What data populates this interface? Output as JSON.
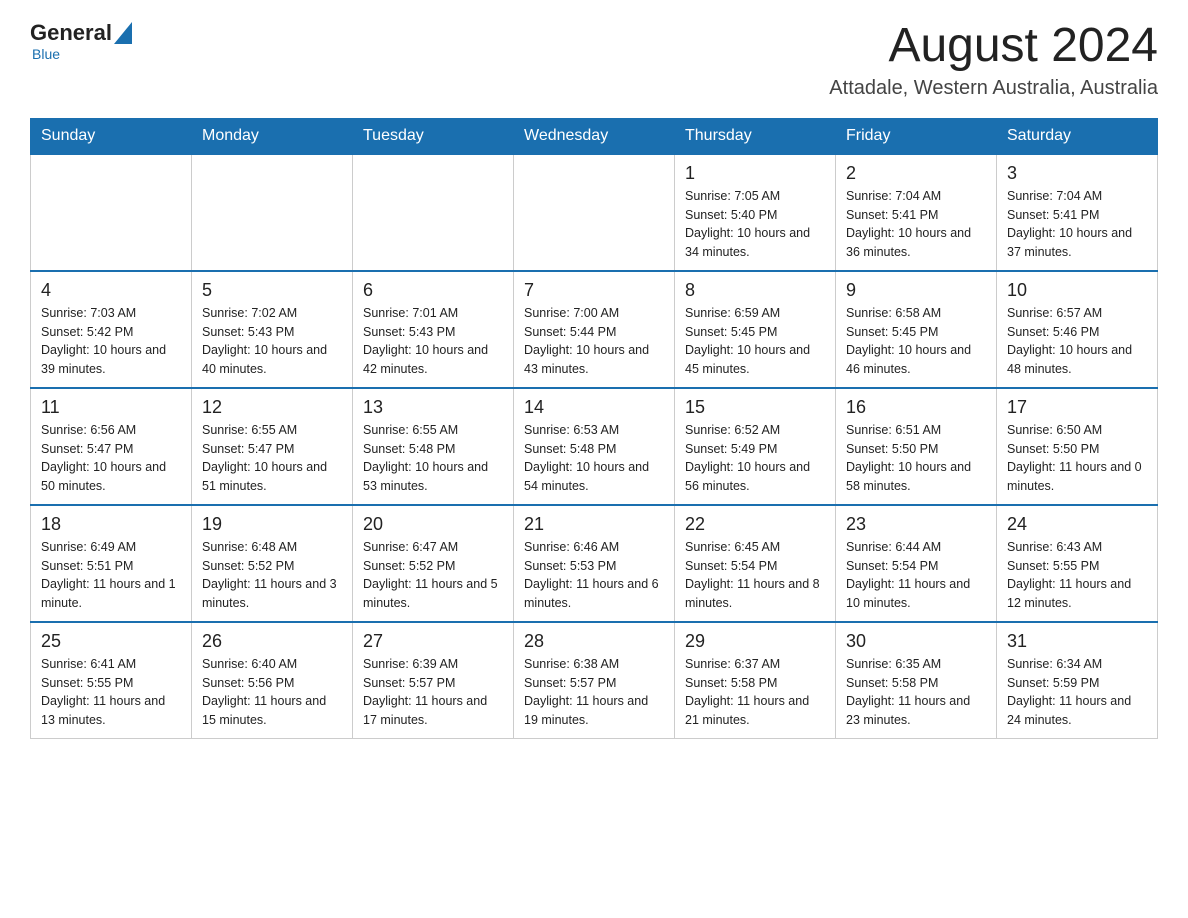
{
  "header": {
    "logo": {
      "general": "General",
      "blue": "Blue"
    },
    "month": "August 2024",
    "location": "Attadale, Western Australia, Australia"
  },
  "weekdays": [
    "Sunday",
    "Monday",
    "Tuesday",
    "Wednesday",
    "Thursday",
    "Friday",
    "Saturday"
  ],
  "weeks": [
    [
      {
        "day": "",
        "info": ""
      },
      {
        "day": "",
        "info": ""
      },
      {
        "day": "",
        "info": ""
      },
      {
        "day": "",
        "info": ""
      },
      {
        "day": "1",
        "info": "Sunrise: 7:05 AM\nSunset: 5:40 PM\nDaylight: 10 hours and 34 minutes."
      },
      {
        "day": "2",
        "info": "Sunrise: 7:04 AM\nSunset: 5:41 PM\nDaylight: 10 hours and 36 minutes."
      },
      {
        "day": "3",
        "info": "Sunrise: 7:04 AM\nSunset: 5:41 PM\nDaylight: 10 hours and 37 minutes."
      }
    ],
    [
      {
        "day": "4",
        "info": "Sunrise: 7:03 AM\nSunset: 5:42 PM\nDaylight: 10 hours and 39 minutes."
      },
      {
        "day": "5",
        "info": "Sunrise: 7:02 AM\nSunset: 5:43 PM\nDaylight: 10 hours and 40 minutes."
      },
      {
        "day": "6",
        "info": "Sunrise: 7:01 AM\nSunset: 5:43 PM\nDaylight: 10 hours and 42 minutes."
      },
      {
        "day": "7",
        "info": "Sunrise: 7:00 AM\nSunset: 5:44 PM\nDaylight: 10 hours and 43 minutes."
      },
      {
        "day": "8",
        "info": "Sunrise: 6:59 AM\nSunset: 5:45 PM\nDaylight: 10 hours and 45 minutes."
      },
      {
        "day": "9",
        "info": "Sunrise: 6:58 AM\nSunset: 5:45 PM\nDaylight: 10 hours and 46 minutes."
      },
      {
        "day": "10",
        "info": "Sunrise: 6:57 AM\nSunset: 5:46 PM\nDaylight: 10 hours and 48 minutes."
      }
    ],
    [
      {
        "day": "11",
        "info": "Sunrise: 6:56 AM\nSunset: 5:47 PM\nDaylight: 10 hours and 50 minutes."
      },
      {
        "day": "12",
        "info": "Sunrise: 6:55 AM\nSunset: 5:47 PM\nDaylight: 10 hours and 51 minutes."
      },
      {
        "day": "13",
        "info": "Sunrise: 6:55 AM\nSunset: 5:48 PM\nDaylight: 10 hours and 53 minutes."
      },
      {
        "day": "14",
        "info": "Sunrise: 6:53 AM\nSunset: 5:48 PM\nDaylight: 10 hours and 54 minutes."
      },
      {
        "day": "15",
        "info": "Sunrise: 6:52 AM\nSunset: 5:49 PM\nDaylight: 10 hours and 56 minutes."
      },
      {
        "day": "16",
        "info": "Sunrise: 6:51 AM\nSunset: 5:50 PM\nDaylight: 10 hours and 58 minutes."
      },
      {
        "day": "17",
        "info": "Sunrise: 6:50 AM\nSunset: 5:50 PM\nDaylight: 11 hours and 0 minutes."
      }
    ],
    [
      {
        "day": "18",
        "info": "Sunrise: 6:49 AM\nSunset: 5:51 PM\nDaylight: 11 hours and 1 minute."
      },
      {
        "day": "19",
        "info": "Sunrise: 6:48 AM\nSunset: 5:52 PM\nDaylight: 11 hours and 3 minutes."
      },
      {
        "day": "20",
        "info": "Sunrise: 6:47 AM\nSunset: 5:52 PM\nDaylight: 11 hours and 5 minutes."
      },
      {
        "day": "21",
        "info": "Sunrise: 6:46 AM\nSunset: 5:53 PM\nDaylight: 11 hours and 6 minutes."
      },
      {
        "day": "22",
        "info": "Sunrise: 6:45 AM\nSunset: 5:54 PM\nDaylight: 11 hours and 8 minutes."
      },
      {
        "day": "23",
        "info": "Sunrise: 6:44 AM\nSunset: 5:54 PM\nDaylight: 11 hours and 10 minutes."
      },
      {
        "day": "24",
        "info": "Sunrise: 6:43 AM\nSunset: 5:55 PM\nDaylight: 11 hours and 12 minutes."
      }
    ],
    [
      {
        "day": "25",
        "info": "Sunrise: 6:41 AM\nSunset: 5:55 PM\nDaylight: 11 hours and 13 minutes."
      },
      {
        "day": "26",
        "info": "Sunrise: 6:40 AM\nSunset: 5:56 PM\nDaylight: 11 hours and 15 minutes."
      },
      {
        "day": "27",
        "info": "Sunrise: 6:39 AM\nSunset: 5:57 PM\nDaylight: 11 hours and 17 minutes."
      },
      {
        "day": "28",
        "info": "Sunrise: 6:38 AM\nSunset: 5:57 PM\nDaylight: 11 hours and 19 minutes."
      },
      {
        "day": "29",
        "info": "Sunrise: 6:37 AM\nSunset: 5:58 PM\nDaylight: 11 hours and 21 minutes."
      },
      {
        "day": "30",
        "info": "Sunrise: 6:35 AM\nSunset: 5:58 PM\nDaylight: 11 hours and 23 minutes."
      },
      {
        "day": "31",
        "info": "Sunrise: 6:34 AM\nSunset: 5:59 PM\nDaylight: 11 hours and 24 minutes."
      }
    ]
  ]
}
